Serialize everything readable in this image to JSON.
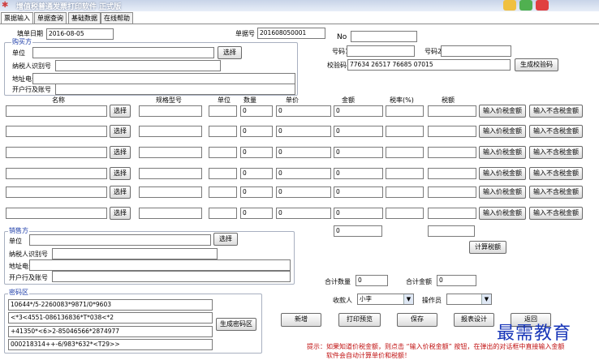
{
  "window": {
    "title": "增值税普通发票打印软件  正式版"
  },
  "tabs": [
    "票据输入",
    "单据查询",
    "基础数据",
    "在线帮助"
  ],
  "header": {
    "fill_date_label": "填单日期",
    "fill_date": "2016-08-05",
    "doc_no_label": "单据号",
    "doc_no": "201608050001",
    "no_label": "No",
    "no_value": "",
    "code1_label": "号码1",
    "code1": "",
    "code2_label": "号码2",
    "code2": "",
    "check_label": "校验码",
    "check_code": "77634 26517 76685 07015",
    "gen_check_button": "生成校验码"
  },
  "buyer": {
    "legend": "购买方",
    "unit_label": "单位",
    "unit": "",
    "select_button": "选择",
    "tax_id_label": "纳税人识别号",
    "tax_id": "",
    "address_label": "地址电话",
    "address": "",
    "bank_label": "开户行及账号",
    "bank": ""
  },
  "items": {
    "headers": [
      "名称",
      "规格型号",
      "单位",
      "数量",
      "单价",
      "金额",
      "税率(%)",
      "税额"
    ],
    "select_button": "选择",
    "incl_tax_button": "输入价税金额",
    "excl_tax_button": "输入不含税金额",
    "rows": [
      {
        "qty": "0",
        "price": "0",
        "amount": "0"
      },
      {
        "qty": "0",
        "price": "0",
        "amount": "0"
      },
      {
        "qty": "0",
        "price": "0",
        "amount": "0"
      },
      {
        "qty": "0",
        "price": "0",
        "amount": "0"
      },
      {
        "qty": "0",
        "price": "0",
        "amount": "0"
      },
      {
        "qty": "0",
        "price": "0",
        "amount": "0"
      }
    ],
    "total_amount": "0",
    "calc_tax_button": "计算税额"
  },
  "seller": {
    "legend": "销售方",
    "unit_label": "单位",
    "unit": "",
    "select_button": "选择",
    "tax_id_label": "纳税人识别号",
    "tax_id": "",
    "address_label": "地址电话",
    "address": "",
    "bank_label": "开户行及账号",
    "bank": ""
  },
  "password": {
    "legend": "密码区",
    "lines": [
      "10644*/5-2260083*9871/0*9603",
      "<*3<4551-086136836*T*038<*2",
      "+41350*<6>2-85046566*2874977",
      "000218314++-6/983*632*<T29>>"
    ],
    "gen_button": "生成密码区"
  },
  "totals": {
    "qty_label": "合计数量",
    "qty": "0",
    "amount_label": "合计金额",
    "amount": "0"
  },
  "staff": {
    "payee_label": "收款人",
    "payee": "小李",
    "operator_label": "操作员",
    "operator": ""
  },
  "actions": {
    "new": "新增",
    "preview": "打印预览",
    "save": "保存",
    "design": "报表设计",
    "back": "返回"
  },
  "tip": {
    "line1": "提示：如果知道价税金额，则点击 “输入价税金额” 按钮，在弹出的对话框中直接输入金额",
    "line2": "软件会自动计算单价和税额！"
  },
  "watermark": "最需教育"
}
